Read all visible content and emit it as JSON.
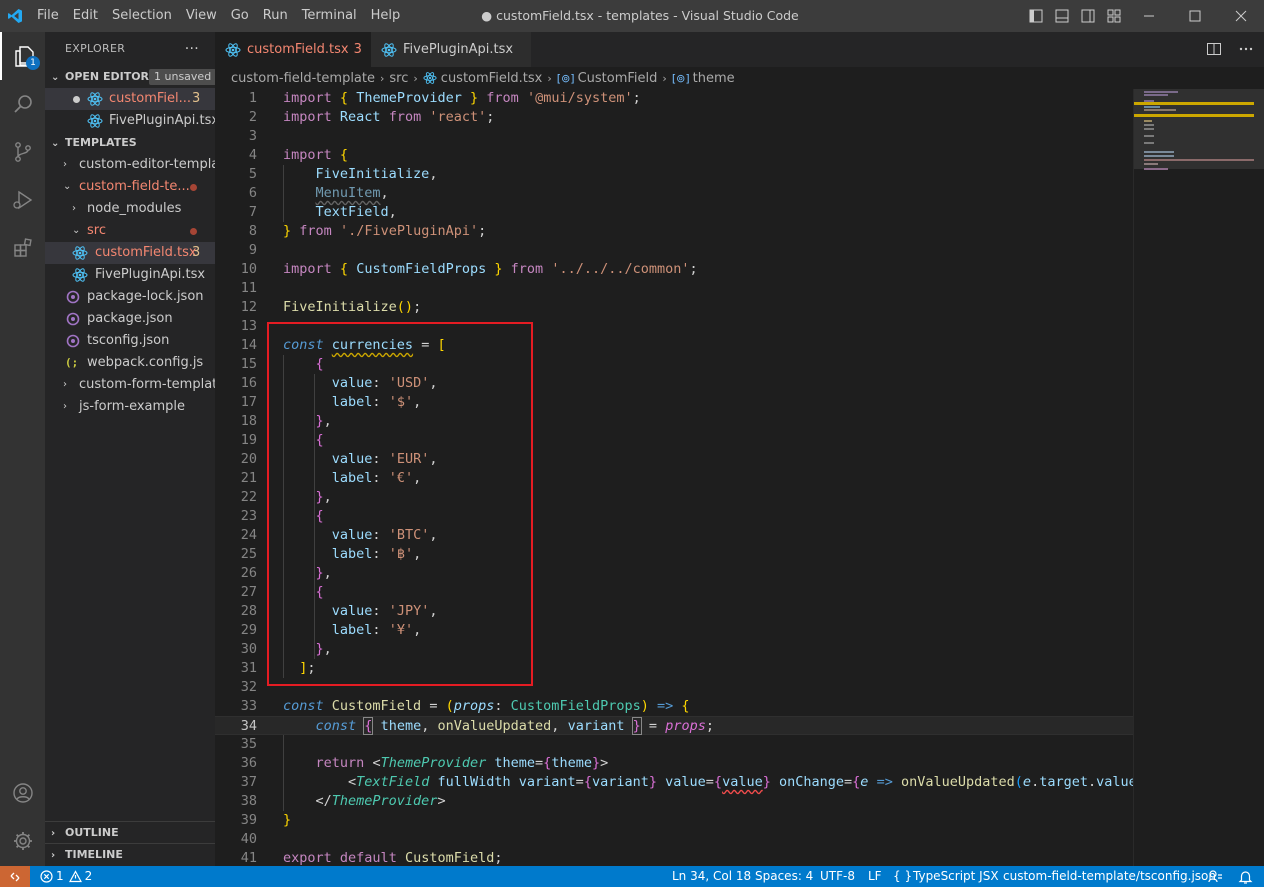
{
  "window": {
    "title": "● customField.tsx - templates - Visual Studio Code",
    "menu": [
      "File",
      "Edit",
      "Selection",
      "View",
      "Go",
      "Run",
      "Terminal",
      "Help"
    ]
  },
  "activity_bar": {
    "explorer_badge": "1",
    "items": [
      "explorer-icon",
      "search-icon",
      "source-control-icon",
      "run-debug-icon",
      "extensions-icon",
      "account-icon",
      "settings-gear-icon"
    ]
  },
  "sidebar": {
    "title": "EXPLORER",
    "more": "···",
    "open_editors": {
      "label": "OPEN EDITORS",
      "unsaved_badge": "1 unsaved",
      "items": [
        {
          "name": "customFiel...",
          "count": "3"
        },
        {
          "name": "FivePluginApi.tsx..."
        }
      ]
    },
    "workspace": {
      "label": "TEMPLATES",
      "items": [
        {
          "name": "custom-editor-templa..."
        },
        {
          "name": "custom-field-te..."
        },
        {
          "name": "node_modules"
        },
        {
          "name": "src"
        },
        {
          "name": "customField.tsx",
          "count": "3"
        },
        {
          "name": "FivePluginApi.tsx"
        },
        {
          "name": "package-lock.json"
        },
        {
          "name": "package.json"
        },
        {
          "name": "tsconfig.json"
        },
        {
          "name": "webpack.config.js"
        },
        {
          "name": "custom-form-template"
        },
        {
          "name": "js-form-example"
        }
      ]
    },
    "outline_label": "OUTLINE",
    "timeline_label": "TIMELINE"
  },
  "tabs": [
    {
      "label": "customField.tsx",
      "count": "3"
    },
    {
      "label": "FivePluginApi.tsx"
    }
  ],
  "breadcrumb": {
    "parts": [
      "custom-field-template",
      "src",
      "customField.tsx",
      "CustomField",
      "theme"
    ]
  },
  "editor": {
    "line_numbers": [
      "1",
      "2",
      "3",
      "4",
      "5",
      "6",
      "7",
      "8",
      "9",
      "10",
      "11",
      "12",
      "13",
      "14",
      "15",
      "16",
      "17",
      "18",
      "19",
      "20",
      "21",
      "22",
      "23",
      "24",
      "25",
      "26",
      "27",
      "28",
      "29",
      "30",
      "31",
      "32",
      "33",
      "34",
      "35",
      "36",
      "37",
      "38",
      "39",
      "40",
      "41"
    ],
    "current_line": "34"
  },
  "status_bar": {
    "errors": "1",
    "warnings": "2",
    "position": "Ln 34, Col 18",
    "spaces": "Spaces: 4",
    "encoding": "UTF-8",
    "eol": "LF",
    "language_brackets": "{ }",
    "language": "TypeScript JSX",
    "tsconfig": "custom-field-template/tsconfig.json"
  },
  "colors": {
    "status_bar": "#007acc",
    "remote": "#cc6633",
    "highlight_box": "#e51c23",
    "modified_file": "#f48771"
  }
}
